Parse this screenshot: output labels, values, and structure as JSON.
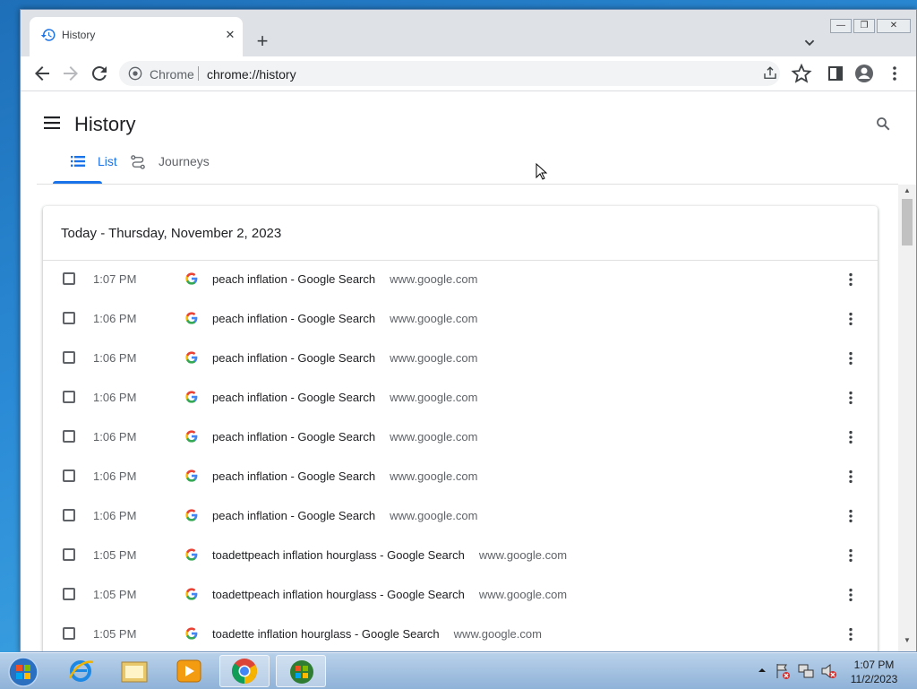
{
  "browser": {
    "tab": {
      "title": "History",
      "close": "✕"
    },
    "new_tab": "+",
    "window_controls": {
      "minimize": "—",
      "maximize": "❐",
      "close": "✕"
    },
    "omnibox": {
      "site": "Chrome",
      "url": "chrome://history"
    }
  },
  "page": {
    "title": "History",
    "tabs": [
      {
        "label": "List",
        "icon": "list-icon",
        "selected": true
      },
      {
        "label": "Journeys",
        "icon": "journeys-icon",
        "selected": false
      }
    ],
    "date_header": "Today - Thursday, November 2, 2023",
    "entries": [
      {
        "time": "1:07 PM",
        "title": "peach inflation - Google Search",
        "domain": "www.google.com"
      },
      {
        "time": "1:06 PM",
        "title": "peach inflation - Google Search",
        "domain": "www.google.com"
      },
      {
        "time": "1:06 PM",
        "title": "peach inflation - Google Search",
        "domain": "www.google.com"
      },
      {
        "time": "1:06 PM",
        "title": "peach inflation - Google Search",
        "domain": "www.google.com"
      },
      {
        "time": "1:06 PM",
        "title": "peach inflation - Google Search",
        "domain": "www.google.com"
      },
      {
        "time": "1:06 PM",
        "title": "peach inflation - Google Search",
        "domain": "www.google.com"
      },
      {
        "time": "1:06 PM",
        "title": "peach inflation - Google Search",
        "domain": "www.google.com"
      },
      {
        "time": "1:05 PM",
        "title": "toadettpeach inflation hourglass - Google Search",
        "domain": "www.google.com"
      },
      {
        "time": "1:05 PM",
        "title": "toadettpeach inflation hourglass - Google Search",
        "domain": "www.google.com"
      },
      {
        "time": "1:05 PM",
        "title": "toadette inflation hourglass - Google Search",
        "domain": "www.google.com"
      }
    ]
  },
  "taskbar": {
    "apps": [
      "internet-explorer",
      "windows-explorer",
      "media-player",
      "chrome",
      "windows-logo-app"
    ],
    "clock": {
      "time": "1:07 PM",
      "date": "11/2/2023"
    }
  },
  "colors": {
    "accent": "#1a73e8",
    "tabstrip": "#dee1e6"
  }
}
